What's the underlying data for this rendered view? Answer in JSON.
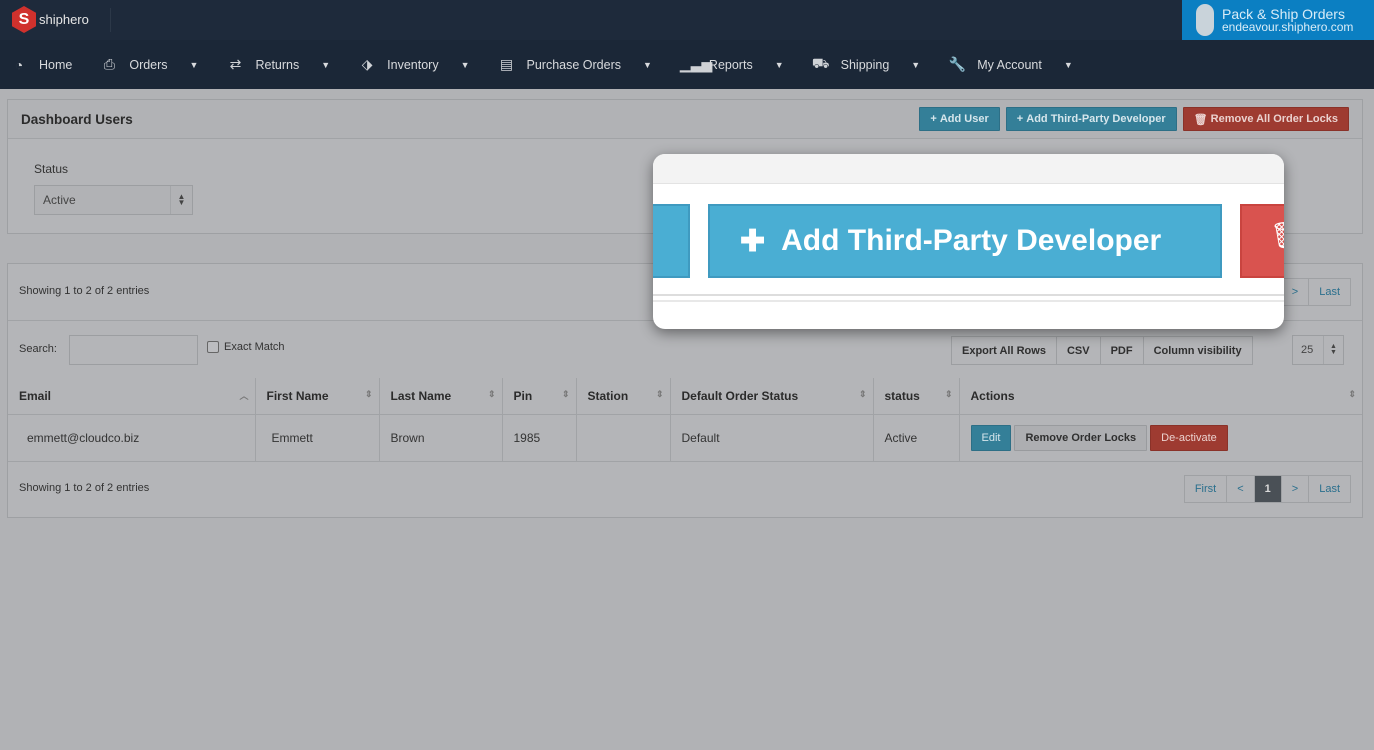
{
  "header": {
    "logo_text": "shiphero",
    "pack_title": "Pack & Ship Orders",
    "pack_subtitle": "endeavour.shiphero.com"
  },
  "nav": [
    {
      "label": "Home",
      "icon": "dashboard-icon",
      "dropdown": false
    },
    {
      "label": "Orders",
      "icon": "inbox-icon",
      "dropdown": true
    },
    {
      "label": "Returns",
      "icon": "exchange-icon",
      "dropdown": true
    },
    {
      "label": "Inventory",
      "icon": "tags-icon",
      "dropdown": true
    },
    {
      "label": "Purchase Orders",
      "icon": "archive-icon",
      "dropdown": true
    },
    {
      "label": "Reports",
      "icon": "signal-icon",
      "dropdown": true
    },
    {
      "label": "Shipping",
      "icon": "truck-icon",
      "dropdown": true
    },
    {
      "label": "My Account",
      "icon": "wrench-icon",
      "dropdown": true
    }
  ],
  "page": {
    "title": "Dashboard Users",
    "add_user": "Add User",
    "add_dev": "Add Third-Party Developer",
    "remove_locks": "Remove All Order Locks"
  },
  "filter": {
    "status_label": "Status",
    "status_value": "Active"
  },
  "table": {
    "showing": "Showing 1 to 2 of 2 entries",
    "search_label": "Search:",
    "search_value": "",
    "exact_match": "Exact Match",
    "exports": [
      "Export All Rows",
      "CSV",
      "PDF",
      "Column visibility"
    ],
    "page_length": "25",
    "columns": [
      "Email",
      "First Name",
      "Last Name",
      "Pin",
      "Station",
      "Default Order Status",
      "status",
      "Actions"
    ],
    "rows": [
      {
        "email": "emmett@cloudco.biz",
        "first": "Emmett",
        "last": "Brown",
        "pin": "1985",
        "station": "",
        "default_status": "Default",
        "status": "Active"
      }
    ],
    "row_actions": {
      "edit": "Edit",
      "remove_locks": "Remove Order Locks",
      "deactivate": "De-activate"
    },
    "pager": {
      "first": "First",
      "prev": "<",
      "current": "1",
      "next": ">",
      "last": "Last"
    }
  },
  "magnifier": {
    "label": "Add Third-Party Developer"
  },
  "colors": {
    "nav_bg": "#1b2737",
    "primary": "#347f98",
    "danger": "#9e3b31",
    "pack_bg": "#0b7fc2"
  }
}
